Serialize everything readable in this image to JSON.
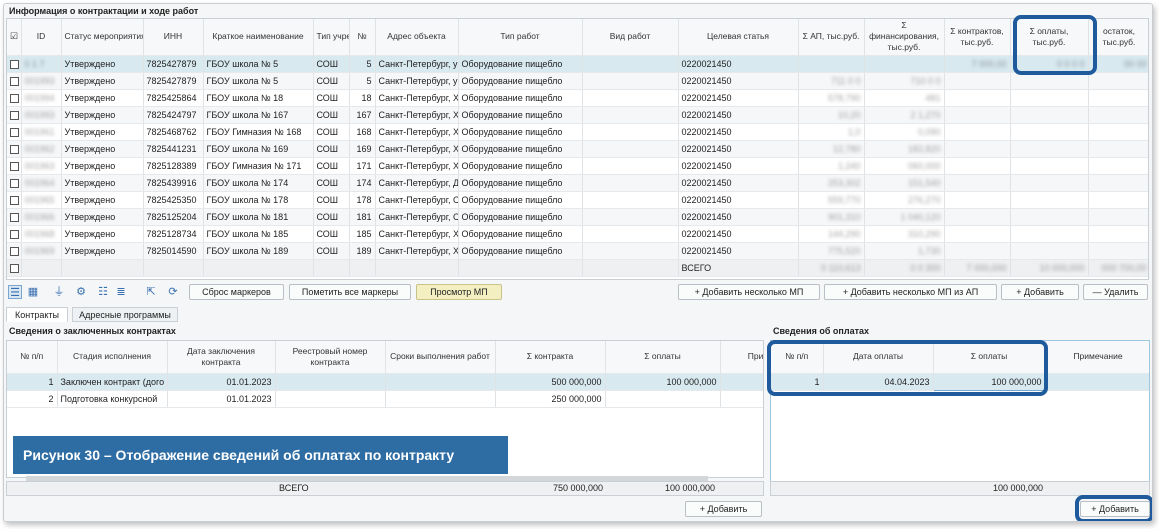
{
  "top_section": {
    "title": "Информация о контрактации и ходе работ",
    "columns": [
      "ID",
      "Статус мероприятия",
      "ИНН",
      "Краткое наименование",
      "Тип учреж,",
      "№",
      "Адрес объекта",
      "Тип работ",
      "Вид работ",
      "Целевая статья",
      "Σ АП, тыс.руб.",
      "Σ финансирования, тыс.руб.",
      "Σ контрактов, тыс.руб.",
      "Σ оплаты, тыс.руб.",
      "остаток, тыс.руб."
    ],
    "rows": [
      {
        "id": "0 1 7",
        "status": "Утверждено",
        "inn": "7825427879",
        "name": "ГБОУ школа № 5",
        "type": "СОШ",
        "num": "5",
        "addr": "Санкт-Петербург, у",
        "work": "Оборудование пищебло",
        "article": "0220021450",
        "ap": "",
        "fin": "",
        "contr": "7 000,00",
        "pay": "0 0 0 0",
        "rest": "00 00"
      },
      {
        "id": "001993",
        "status": "Утверждено",
        "inn": "7825427879",
        "name": "ГБОУ школа № 5",
        "type": "СОШ",
        "num": "5",
        "addr": "Санкт-Петербург, у",
        "work": "Оборудование пищебло",
        "article": "0220021450",
        "ap": "711 0 0",
        "fin": "710 0 0",
        "contr": "",
        "pay": "",
        "rest": ""
      },
      {
        "id": "001994",
        "status": "Утверждено",
        "inn": "7825425864",
        "name": "ГБОУ школа № 18",
        "type": "СОШ",
        "num": "18",
        "addr": "Санкт-Петербург, Х",
        "work": "Оборудование пищебло",
        "article": "0220021450",
        "ap": "578,790",
        "fin": "481",
        "contr": "",
        "pay": "",
        "rest": ""
      },
      {
        "id": "001993",
        "status": "Утверждено",
        "inn": "7825424797",
        "name": "ГБОУ школа № 167",
        "type": "СОШ",
        "num": "167",
        "addr": "Санкт-Петербург, Х",
        "work": "Оборудование пищебло",
        "article": "0220021450",
        "ap": "10,20",
        "fin": "2 1,270",
        "contr": "",
        "pay": "",
        "rest": ""
      },
      {
        "id": "001961",
        "status": "Утверждено",
        "inn": "7825468762",
        "name": "ГБОУ Гимназия № 168",
        "type": "СОШ",
        "num": "168",
        "addr": "Санкт-Петербург, Х",
        "work": "Оборудование пищебло",
        "article": "0220021450",
        "ap": "1,0",
        "fin": "0,090",
        "contr": "",
        "pay": "",
        "rest": ""
      },
      {
        "id": "001962",
        "status": "Утверждено",
        "inn": "7825441231",
        "name": "ГБОУ школа № 169",
        "type": "СОШ",
        "num": "169",
        "addr": "Санкт-Петербург, Х",
        "work": "Оборудование пищебло",
        "article": "0220021450",
        "ap": "12,780",
        "fin": "182,820",
        "contr": "",
        "pay": "",
        "rest": ""
      },
      {
        "id": "001963",
        "status": "Утверждено",
        "inn": "7825128389",
        "name": "ГБОУ Гимназия № 171",
        "type": "СОШ",
        "num": "171",
        "addr": "Санкт-Петербург, Х",
        "work": "Оборудование пищебло",
        "article": "0220021450",
        "ap": "1,240",
        "fin": "060,000",
        "contr": "",
        "pay": "",
        "rest": ""
      },
      {
        "id": "001964",
        "status": "Утверждено",
        "inn": "7825439916",
        "name": "ГБОУ школа № 174",
        "type": "СОШ",
        "num": "174",
        "addr": "Санкт-Петербург, Д",
        "work": "Оборудование пищебло",
        "article": "0220021450",
        "ap": "253,302",
        "fin": "151,540",
        "contr": "",
        "pay": "",
        "rest": ""
      },
      {
        "id": "001965",
        "status": "Утверждено",
        "inn": "7825425350",
        "name": "ГБОУ школа № 178",
        "type": "СОШ",
        "num": "178",
        "addr": "Санкт-Петербург, С",
        "work": "Оборудование пищебло",
        "article": "0220021450",
        "ap": "559,770",
        "fin": "276,270",
        "contr": "",
        "pay": "",
        "rest": ""
      },
      {
        "id": "001966",
        "status": "Утверждено",
        "inn": "7825125204",
        "name": "ГБОУ школа № 181",
        "type": "СОШ",
        "num": "181",
        "addr": "Санкт-Петербург, С",
        "work": "Оборудование пищебло",
        "article": "0220021450",
        "ap": "901,310",
        "fin": "1 040,120",
        "contr": "",
        "pay": "",
        "rest": ""
      },
      {
        "id": "001968",
        "status": "Утверждено",
        "inn": "7825128734",
        "name": "ГБОУ школа № 185",
        "type": "СОШ",
        "num": "185",
        "addr": "Санкт-Петербург, Х",
        "work": "Оборудование пищебло",
        "article": "0220021450",
        "ap": "144,290",
        "fin": "310,290",
        "contr": "",
        "pay": "",
        "rest": ""
      },
      {
        "id": "001969",
        "status": "Утверждено",
        "inn": "7825014590",
        "name": "ГБОУ школа № 189",
        "type": "СОШ",
        "num": "189",
        "addr": "Санкт-Петербург, Х",
        "work": "Оборудование пищебло",
        "article": "0220021450",
        "ap": "775,520",
        "fin": "1,730",
        "contr": "",
        "pay": "",
        "rest": ""
      }
    ],
    "total_label": "ВСЕГО",
    "totals": {
      "ap": "0 110,613",
      "fin": "0 0 300",
      "contr": "7 000,000",
      "pay": "10 000,000",
      "rest": "000 700,00"
    }
  },
  "toolbar": {
    "reset_markers": "Сброс маркеров",
    "mark_all": "Пометить все маркеры",
    "view_mp": "Просмотр МП",
    "add_several_mp": "+ Добавить несколько МП",
    "add_several_mp_ap": "+ Добавить несколько МП из АП",
    "add": "+ Добавить",
    "delete": "— Удалить"
  },
  "tabs": [
    "Контракты",
    "Адресные программы"
  ],
  "contracts": {
    "title": "Сведения о заключенных контрактах",
    "columns": [
      "№ п/п",
      "Стадия исполнения",
      "Дата заключения контракта",
      "Реестровый номер контракта",
      "Сроки выполнения работ",
      "Σ контракта",
      "Σ оплаты",
      "Прим"
    ],
    "rows": [
      {
        "n": "1",
        "stage": "Заключен контракт (дого",
        "date": "01.01.2023",
        "reg": "",
        "term": "",
        "sum": "500 000,000",
        "pay": "100 000,000"
      },
      {
        "n": "2",
        "stage": "Подготовка конкурсной",
        "date": "01.01.2023",
        "reg": "",
        "term": "",
        "sum": "250 000,000",
        "pay": ""
      }
    ],
    "total_label": "ВСЕГО",
    "total_sum": "750 000,000",
    "total_pay": "100 000,000",
    "add": "+ Добавить"
  },
  "payments": {
    "title": "Сведения об оплатах",
    "columns": [
      "№ п/п",
      "Дата оплаты",
      "Σ оплаты",
      "Примечание"
    ],
    "rows": [
      {
        "n": "1",
        "date": "04.04.2023",
        "sum": "100 000,000",
        "note": ""
      }
    ],
    "total": "100 000,000",
    "add": "+ Добавить"
  },
  "caption": "Рисунок 30 –  Отображение сведений об оплатах по контракту",
  "colors": {
    "accent": "#1f5a9c",
    "selected_row": "#d8e9f0",
    "caption_bg": "#2e6da4"
  }
}
